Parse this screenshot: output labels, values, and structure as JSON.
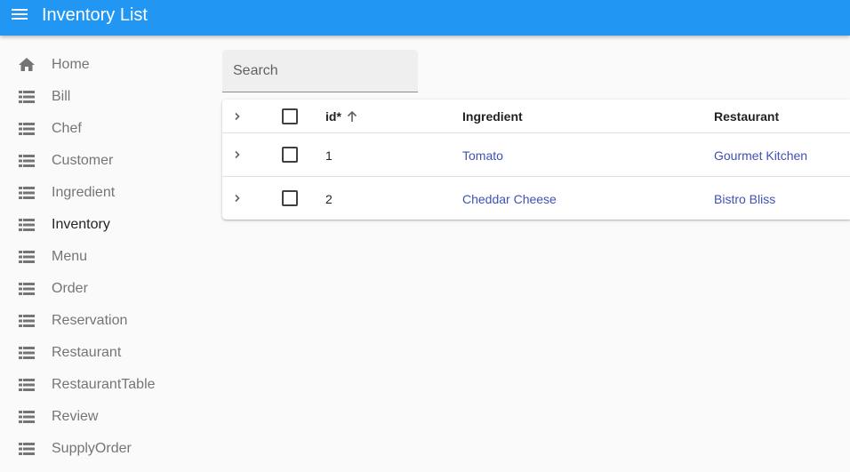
{
  "appbar": {
    "title": "Inventory List",
    "color": "#2196f3"
  },
  "sidebar": {
    "items": [
      {
        "label": "Home",
        "icon": "home-icon"
      },
      {
        "label": "Bill",
        "icon": "list-icon"
      },
      {
        "label": "Chef",
        "icon": "list-icon"
      },
      {
        "label": "Customer",
        "icon": "list-icon"
      },
      {
        "label": "Ingredient",
        "icon": "list-icon"
      },
      {
        "label": "Inventory",
        "icon": "list-icon",
        "active": true
      },
      {
        "label": "Menu",
        "icon": "list-icon"
      },
      {
        "label": "Order",
        "icon": "list-icon"
      },
      {
        "label": "Reservation",
        "icon": "list-icon"
      },
      {
        "label": "Restaurant",
        "icon": "list-icon"
      },
      {
        "label": "RestaurantTable",
        "icon": "list-icon"
      },
      {
        "label": "Review",
        "icon": "list-icon"
      },
      {
        "label": "SupplyOrder",
        "icon": "list-icon"
      }
    ]
  },
  "search": {
    "placeholder": "Search",
    "value": ""
  },
  "table": {
    "columns": {
      "id": "id*",
      "ingredient": "Ingredient",
      "restaurant": "Restaurant"
    },
    "sort": {
      "column": "id",
      "direction": "ascending"
    },
    "rows": [
      {
        "id": "1",
        "ingredient": "Tomato",
        "restaurant": "Gourmet Kitchen"
      },
      {
        "id": "2",
        "ingredient": "Cheddar Cheese",
        "restaurant": "Bistro Bliss"
      }
    ],
    "link_color": "#3f51b5"
  }
}
